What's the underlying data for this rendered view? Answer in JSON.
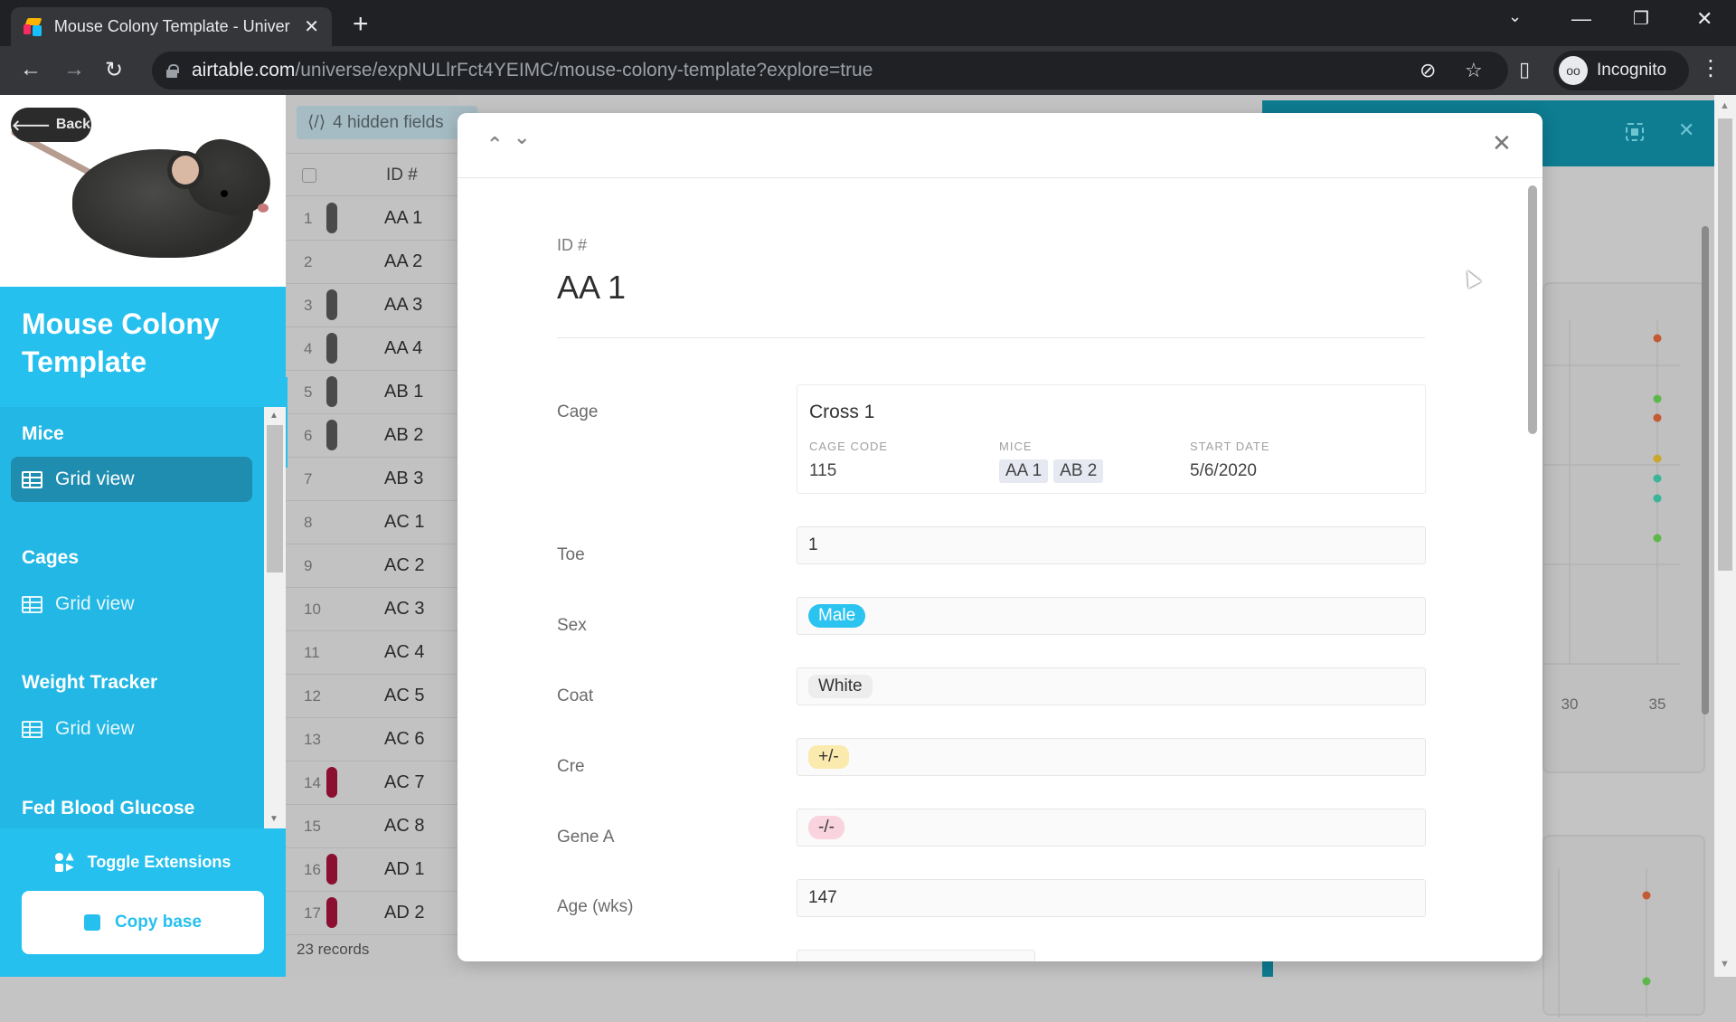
{
  "browser": {
    "tab_title": "Mouse Colony Template - Univer",
    "url_host": "airtable.com",
    "url_path": "/universe/expNULlrFct4YEIMC/mouse-colony-template?explore=true",
    "profile_label": "Incognito"
  },
  "sidebar": {
    "back_label": "Back",
    "base_title": "Mouse Colony Template",
    "sections": [
      {
        "title": "Mice",
        "views": [
          {
            "label": "Grid view",
            "active": true
          }
        ]
      },
      {
        "title": "Cages",
        "views": [
          {
            "label": "Grid view",
            "active": false
          }
        ]
      },
      {
        "title": "Weight Tracker",
        "views": [
          {
            "label": "Grid view",
            "active": false
          }
        ]
      },
      {
        "title": "Fed Blood Glucose",
        "views": []
      }
    ],
    "toggle_extensions_label": "Toggle Extensions",
    "copy_base_label": "Copy base",
    "accent_color": "#26c0ef"
  },
  "grid": {
    "hidden_fields_label": "4 hidden fields",
    "column_header": "ID #",
    "rows": [
      {
        "num": "1",
        "id": "AA 1",
        "tag": "dark"
      },
      {
        "num": "2",
        "id": "AA 2",
        "tag": ""
      },
      {
        "num": "3",
        "id": "AA 3",
        "tag": "dark"
      },
      {
        "num": "4",
        "id": "AA 4",
        "tag": "dark"
      },
      {
        "num": "5",
        "id": "AB 1",
        "tag": "dark"
      },
      {
        "num": "6",
        "id": "AB 2",
        "tag": "dark"
      },
      {
        "num": "7",
        "id": "AB 3",
        "tag": ""
      },
      {
        "num": "8",
        "id": "AC 1",
        "tag": ""
      },
      {
        "num": "9",
        "id": "AC 2",
        "tag": ""
      },
      {
        "num": "10",
        "id": "AC 3",
        "tag": ""
      },
      {
        "num": "11",
        "id": "AC 4",
        "tag": ""
      },
      {
        "num": "12",
        "id": "AC 5",
        "tag": ""
      },
      {
        "num": "13",
        "id": "AC 6",
        "tag": ""
      },
      {
        "num": "14",
        "id": "AC 7",
        "tag": "red"
      },
      {
        "num": "15",
        "id": "AC 8",
        "tag": ""
      },
      {
        "num": "16",
        "id": "AD 1",
        "tag": "red"
      },
      {
        "num": "17",
        "id": "AD 2",
        "tag": "red"
      }
    ],
    "records_count": "23 records",
    "tag_colors": {
      "dark": "#4a4a4a",
      "red": "#8a0f30"
    }
  },
  "record": {
    "primary_label": "ID #",
    "primary_value": "AA 1",
    "cage": {
      "label": "Cage",
      "name": "Cross 1",
      "cage_code_label": "CAGE CODE",
      "cage_code": "115",
      "mice_label": "MICE",
      "mice": [
        "AA 1",
        "AB 2"
      ],
      "start_date_label": "START DATE",
      "start_date": "5/6/2020"
    },
    "fields": [
      {
        "label": "Toe",
        "value": "1",
        "type": "text"
      },
      {
        "label": "Sex",
        "value": "Male",
        "type": "pill-male"
      },
      {
        "label": "Coat",
        "value": "White",
        "type": "pill-white"
      },
      {
        "label": "Cre",
        "value": "+/-",
        "type": "pill-cre"
      },
      {
        "label": "Gene A",
        "value": "-/-",
        "type": "pill-gene"
      },
      {
        "label": "Age (wks)",
        "value": "147",
        "type": "text"
      }
    ]
  },
  "extension": {
    "chart_ticks": [
      "30",
      "35"
    ],
    "dot_colors": [
      "#c45a34",
      "#5cb84a",
      "#c45a34",
      "#c9a82a",
      "#3ab59a",
      "#3ab59a",
      "#5cb84a"
    ]
  }
}
